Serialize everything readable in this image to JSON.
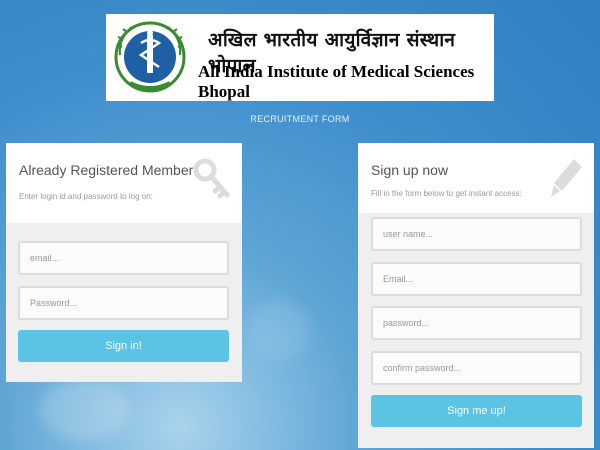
{
  "header": {
    "title_hindi": "अखिल भारतीय आयुर्विज्ञान संस्थान भोपाल",
    "title_english": "All India Institute of Medical Sciences Bhopal"
  },
  "page_label": "RECRUITMENT FORM",
  "login": {
    "title": "Already Registered Member",
    "subtitle": "Enter login id and password to log on:",
    "email_placeholder": "email...",
    "password_placeholder": "Password...",
    "submit_label": "Sign in!",
    "icon": "key-icon"
  },
  "signup": {
    "title": "Sign up now",
    "subtitle": "Fill in the form below to get instant access:",
    "username_placeholder": "user name...",
    "email_placeholder": "Email...",
    "password_placeholder": "password...",
    "confirm_placeholder": "confirm password...",
    "submit_label": "Sign me up!",
    "icon": "pencil-icon"
  },
  "colors": {
    "button": "#5bc3e4",
    "background": "#3f8fcd",
    "logo_green": "#3a8a2f",
    "logo_blue": "#1f5fa6"
  }
}
